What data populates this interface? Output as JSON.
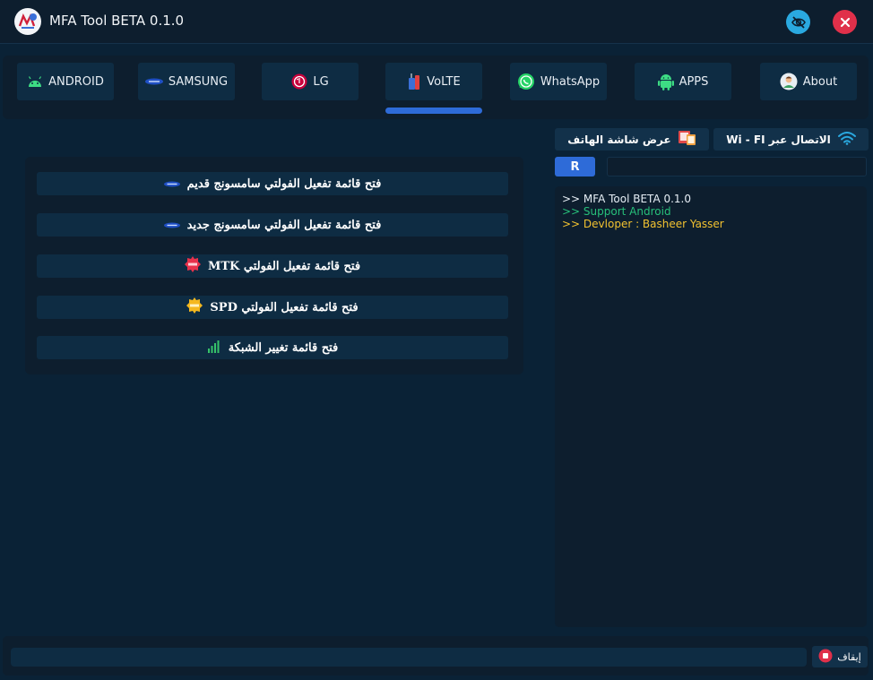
{
  "window": {
    "title": "MFA Tool BETA 0.1.0",
    "logo_icon": "mfa-logo-icon",
    "hide_icon": "eye-slash-icon",
    "close_icon": "close-icon"
  },
  "tabs": [
    {
      "label": "ANDROID",
      "icon": "android-icon"
    },
    {
      "label": "SAMSUNG",
      "icon": "samsung-logo-icon"
    },
    {
      "label": "LG",
      "icon": "lg-logo-icon"
    },
    {
      "label": "VoLTE",
      "icon": "volte-icon",
      "active": true
    },
    {
      "label": "WhatsApp",
      "icon": "whatsapp-icon"
    },
    {
      "label": "APPS",
      "icon": "android-robot-icon"
    },
    {
      "label": "About",
      "icon": "user-avatar-icon"
    }
  ],
  "menu": {
    "items": [
      {
        "label": "فتح قائمة تفعيل الفولتي سامسونج قديم",
        "icon": "samsung-logo-icon"
      },
      {
        "label": "فتح قائمة تفعيل الفولتي سامسونج جديد",
        "icon": "samsung-logo-icon"
      },
      {
        "label": "فتح قائمة تفعيل الفولتي MTK",
        "icon": "new-badge-icon"
      },
      {
        "label": "فتح قائمة تفعيل الفولتي SPD",
        "icon": "new-badge-icon"
      },
      {
        "label": "فتح قائمة تغيير الشبكة",
        "icon": "signal-bars-icon"
      }
    ]
  },
  "right": {
    "screen_button": {
      "label": "عرض شاشة الهاتف",
      "icon": "phone-screen-icon"
    },
    "wifi_button": {
      "label": "الاتصال عبر Wi - FI",
      "icon": "wifi-icon"
    },
    "r_button": "R",
    "input_value": ""
  },
  "console": {
    "lines": [
      {
        "text": ">> MFA Tool BETA 0.1.0",
        "color": "#e6eef5"
      },
      {
        "text": ">> Support Android",
        "color": "#27c07a"
      },
      {
        "text": ">> Devloper : Basheer Yasser",
        "color": "#f2c230"
      }
    ]
  },
  "bottom": {
    "status_value": "",
    "stop_label": "إيقاف",
    "stop_icon": "stop-icon"
  },
  "colors": {
    "accent": "#2e6bd8",
    "close": "#e0304a",
    "eye": "#2aa9e0"
  }
}
